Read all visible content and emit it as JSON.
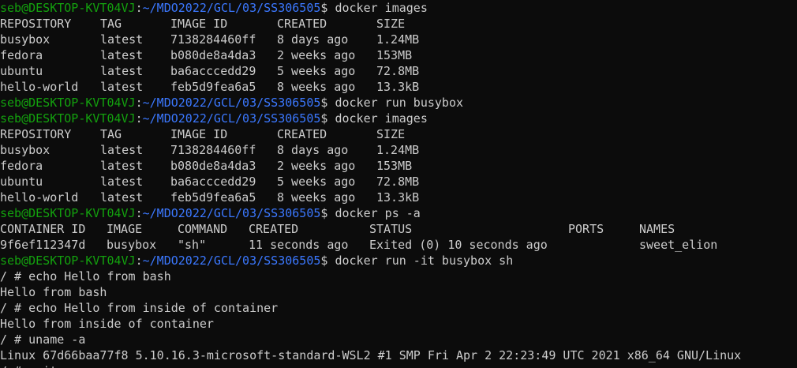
{
  "prompt": {
    "user_host": "seb@DESKTOP-KVT04VJ",
    "separator": ":",
    "path": "~/MDO2022/GCL/03/SS306505",
    "symbol": "$ "
  },
  "colors": {
    "background": "#0c0c0c",
    "text": "#cccccc",
    "user_host": "#13a10e",
    "path": "#3b78ff"
  },
  "images_headers": [
    "REPOSITORY",
    "TAG",
    "IMAGE ID",
    "CREATED",
    "SIZE"
  ],
  "images_rows": [
    [
      "busybox",
      "latest",
      "7138284460ff",
      "8 days ago",
      "1.24MB"
    ],
    [
      "fedora",
      "latest",
      "b080de8a4da3",
      "2 weeks ago",
      "153MB"
    ],
    [
      "ubuntu",
      "latest",
      "ba6acccedd29",
      "5 weeks ago",
      "72.8MB"
    ],
    [
      "hello-world",
      "latest",
      "feb5d9fea6a5",
      "8 weeks ago",
      "13.3kB"
    ]
  ],
  "ps_headers": [
    "CONTAINER ID",
    "IMAGE",
    "COMMAND",
    "CREATED",
    "STATUS",
    "PORTS",
    "NAMES"
  ],
  "ps_rows": [
    [
      "9f6ef112347d",
      "busybox",
      "\"sh\"",
      "11 seconds ago",
      "Exited (0) 10 seconds ago",
      "",
      "sweet_elion"
    ]
  ],
  "commands": [
    "docker images",
    "docker run busybox",
    "docker images",
    "docker ps -a",
    "docker run -it busybox sh"
  ],
  "shell_session": [
    "/ # echo Hello from bash",
    "Hello from bash",
    "/ # echo Hello from inside of container",
    "Hello from inside of container",
    "/ # uname -a",
    "Linux 67d66baa77f8 5.10.16.3-microsoft-standard-WSL2 #1 SMP Fri Apr 2 22:23:49 UTC 2021 x86_64 GNU/Linux",
    "/ # exit"
  ]
}
